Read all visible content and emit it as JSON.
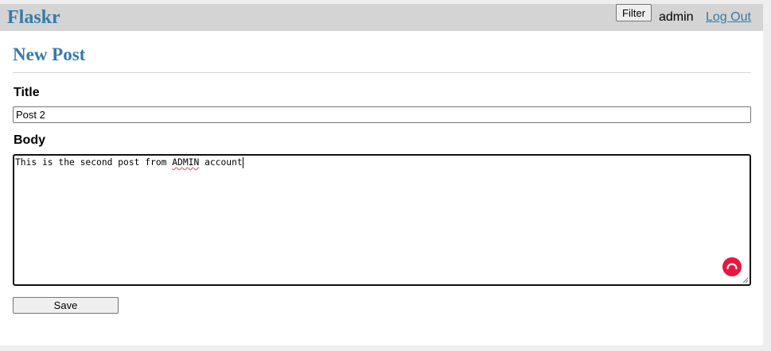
{
  "nav": {
    "brand": "Flaskr",
    "filter_label": "Filter",
    "username": "admin",
    "logout_label": "Log Out"
  },
  "form": {
    "heading": "New Post",
    "title_label": "Title",
    "title_value": "Post 2",
    "body_label": "Body",
    "body_value": {
      "before": "This is the second post from ",
      "flagged_word": "ADMIN",
      "after": " account"
    },
    "save_label": "Save"
  },
  "colors": {
    "brand": "#377ba8",
    "navbar_bg": "#d4d4d4",
    "grammar_assistant": "#e8173f"
  },
  "icons": {
    "grammar_assistant": "grammarly-icon",
    "resize": "resize-grip-icon"
  }
}
